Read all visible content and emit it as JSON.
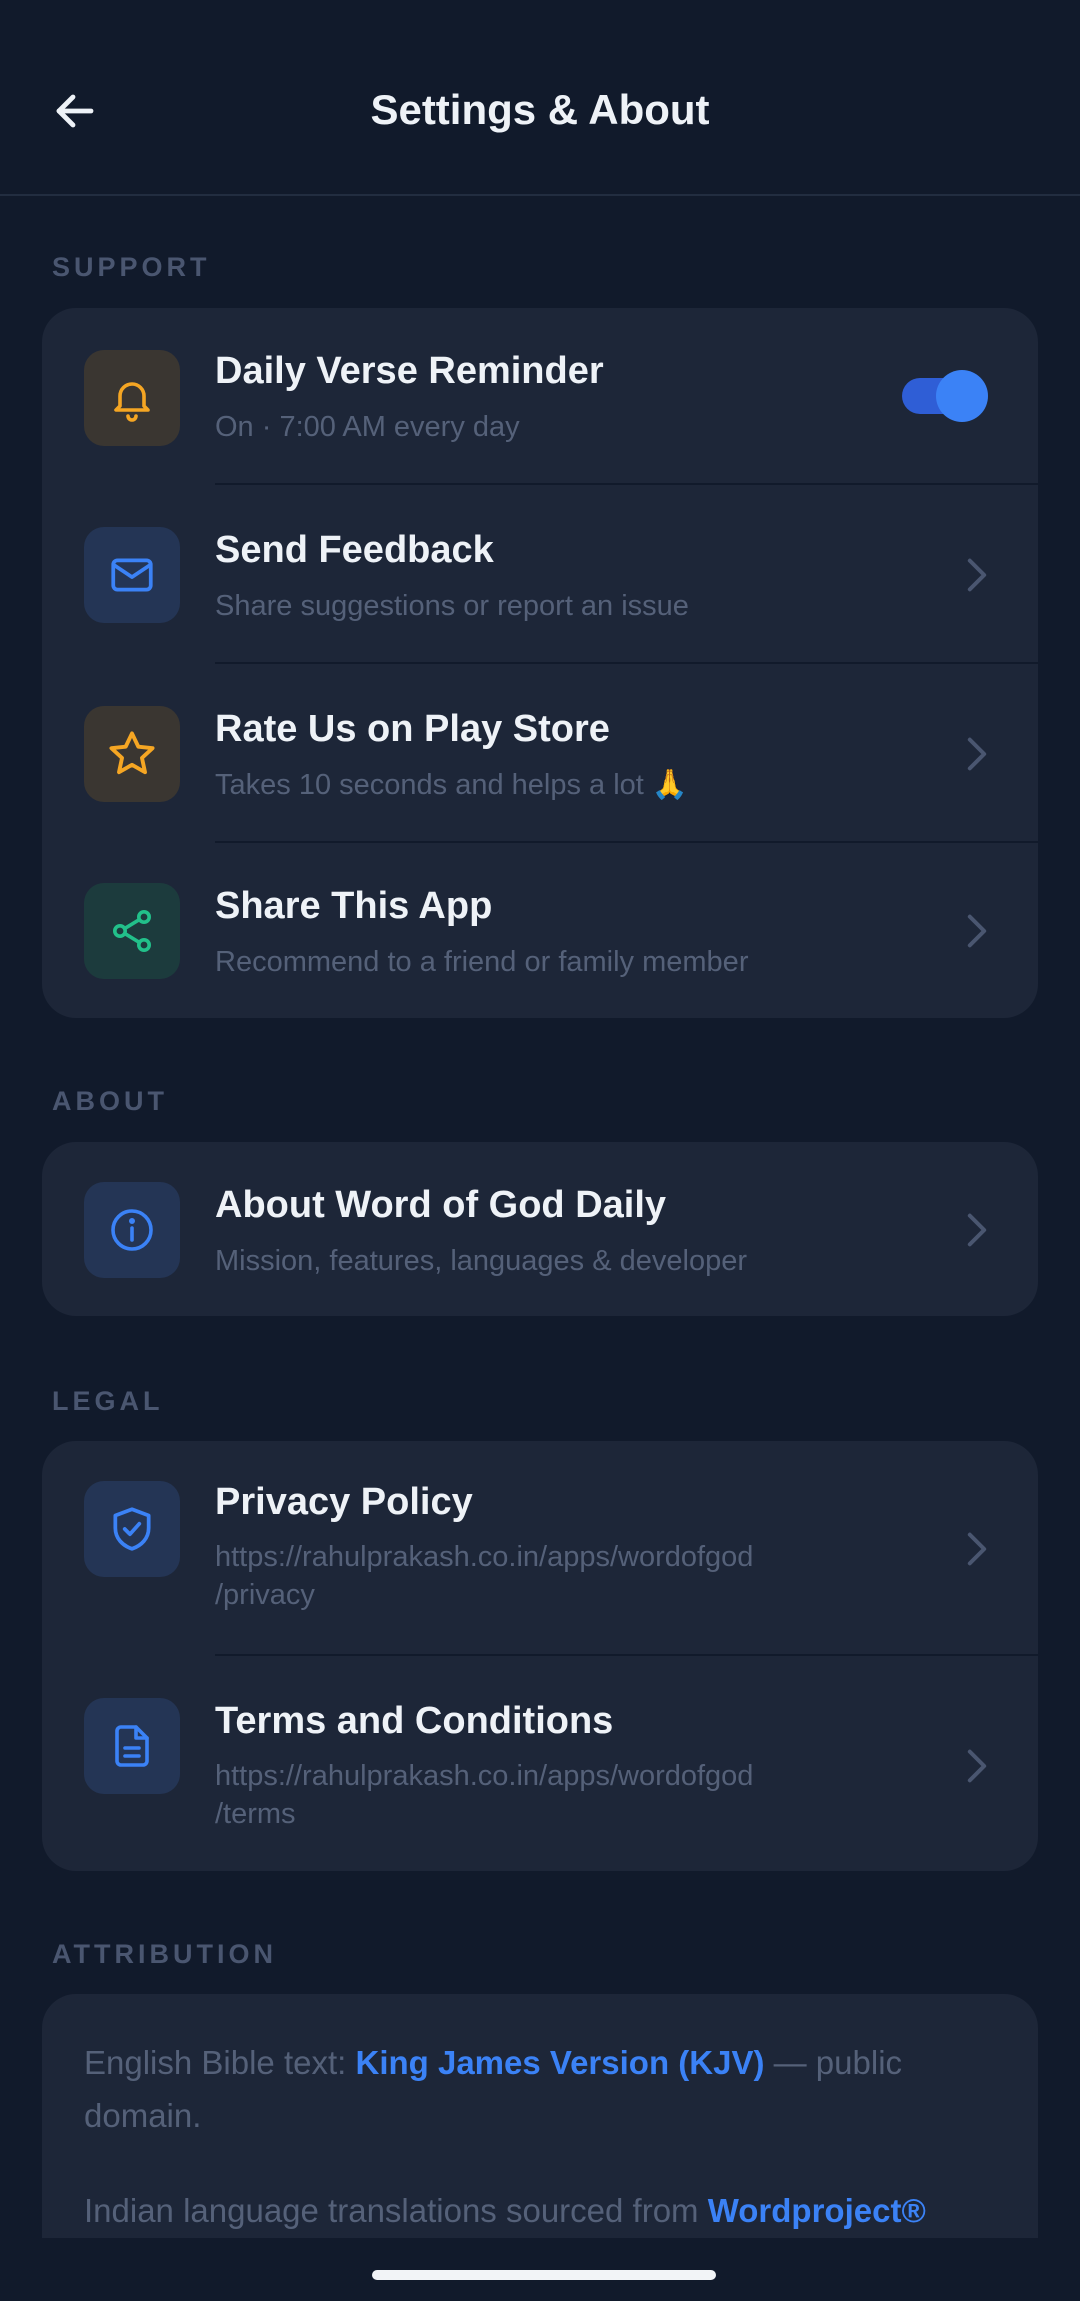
{
  "header": {
    "title": "Settings & About",
    "back_icon": "arrow-left-icon"
  },
  "sections": {
    "support": "SUPPORT",
    "about": "ABOUT",
    "legal": "LEGAL",
    "attribution": "ATTRIBUTION"
  },
  "support_items": {
    "reminder": {
      "title": "Daily Verse Reminder",
      "subtitle": "On · 7:00 AM every day",
      "toggle_on": true,
      "icon": "bell-icon"
    },
    "feedback": {
      "title": "Send Feedback",
      "subtitle": "Share suggestions or report an issue",
      "icon": "mail-icon"
    },
    "rate": {
      "title": "Rate Us on Play Store",
      "subtitle": "Takes 10 seconds and helps a lot 🙏",
      "icon": "star-icon"
    },
    "share": {
      "title": "Share This App",
      "subtitle": "Recommend to a friend or family member",
      "icon": "share-icon"
    }
  },
  "about_items": {
    "about": {
      "title": "About Word of God Daily",
      "subtitle": "Mission, features, languages & developer",
      "icon": "info-icon"
    }
  },
  "legal_items": {
    "privacy": {
      "title": "Privacy Policy",
      "subtitle_line1": "https://rahulprakash.co.in/apps/wordofgod",
      "subtitle_line2": "/privacy",
      "icon": "shield-check-icon"
    },
    "terms": {
      "title": "Terms and Conditions",
      "subtitle_line1": "https://rahulprakash.co.in/apps/wordofgod",
      "subtitle_line2": "/terms",
      "icon": "document-icon"
    }
  },
  "attribution": {
    "p1_prefix": "English Bible text: ",
    "p1_link": "King James Version (KJV)",
    "p1_suffix": " — public domain.",
    "p2_prefix": "Indian language translations sourced from ",
    "p2_link": "Wordproject®"
  },
  "colors": {
    "background": "#111a2b",
    "card": "#1d2638",
    "accent_blue": "#3b82f6",
    "amber": "#f5a623",
    "green": "#22c08a"
  }
}
